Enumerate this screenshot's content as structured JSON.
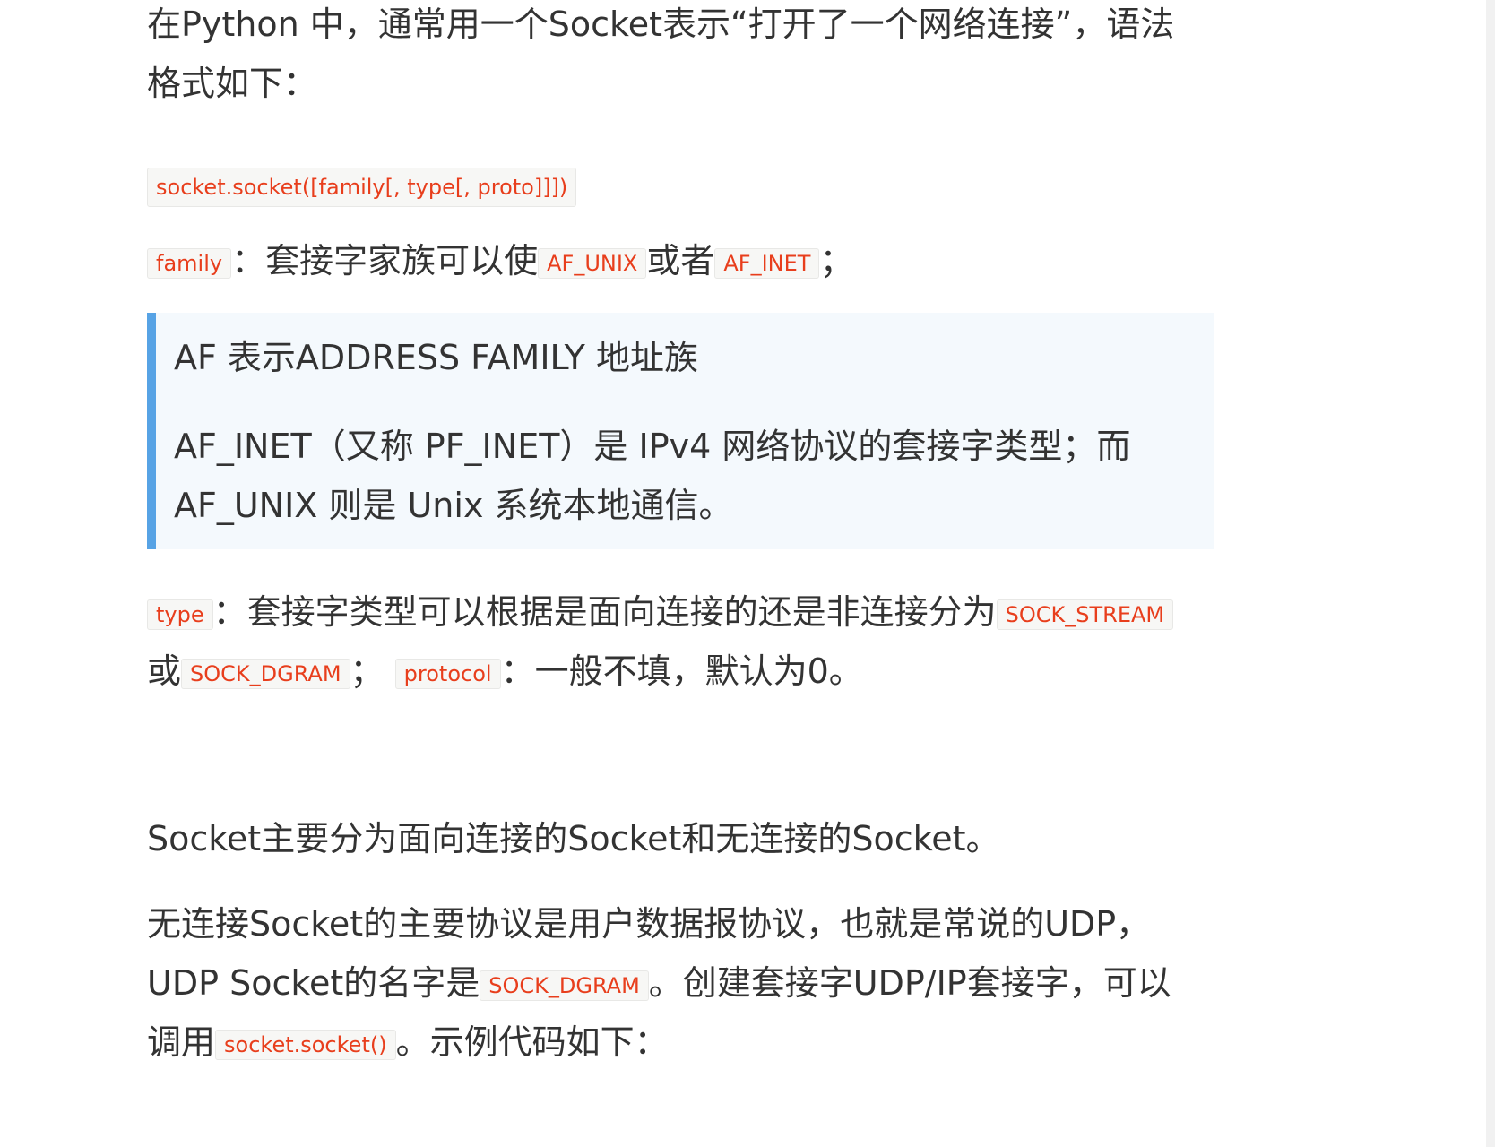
{
  "intro": {
    "line1": "在Python 中，通常用一个Socket表示“打开了一个网络连接”，语法",
    "line2": "格式如下："
  },
  "syntax_code": "socket.socket([family[, type[, proto]]])",
  "family_line": {
    "code_family": "family",
    "text1": "：套接字家族可以使",
    "code_unix": "AF_UNIX",
    "text2": "或者",
    "code_inet": "AF_INET",
    "text3": "；"
  },
  "blockquote": {
    "p1": "AF 表示ADDRESS FAMILY 地址族",
    "p2_line1": "AF_INET（又称 PF_INET）是 IPv4 网络协议的套接字类型；而",
    "p2_line2": "AF_UNIX 则是 Unix 系统本地通信。"
  },
  "type_line": {
    "code_type": "type",
    "text1": "：套接字类型可以根据是面向连接的还是非连接分为",
    "code_stream": "SOCK_STREAM",
    "text2": "或",
    "code_dgram": "SOCK_DGRAM",
    "text3": "；",
    "code_protocol": "protocol",
    "text4": "：一般不填，默认为0。"
  },
  "sock_main": "Socket主要分为面向连接的Socket和无连接的Socket。",
  "udp_para": {
    "text1": "无连接Socket的主要协议是用户数据报协议，也就是常说的UDP，",
    "text2": "UDP Socket的名字是",
    "code_dgram": "SOCK_DGRAM",
    "text3": "。创建套接字UDP/IP套接字，可以",
    "text4": "调用",
    "code_socket": "socket.socket()",
    "text5": "。示例代码如下："
  },
  "colors": {
    "code_text": "#e83e1c",
    "blockquote_border": "#57a3e5",
    "blockquote_bg": "#f4f9fd",
    "body_text": "#333333"
  }
}
